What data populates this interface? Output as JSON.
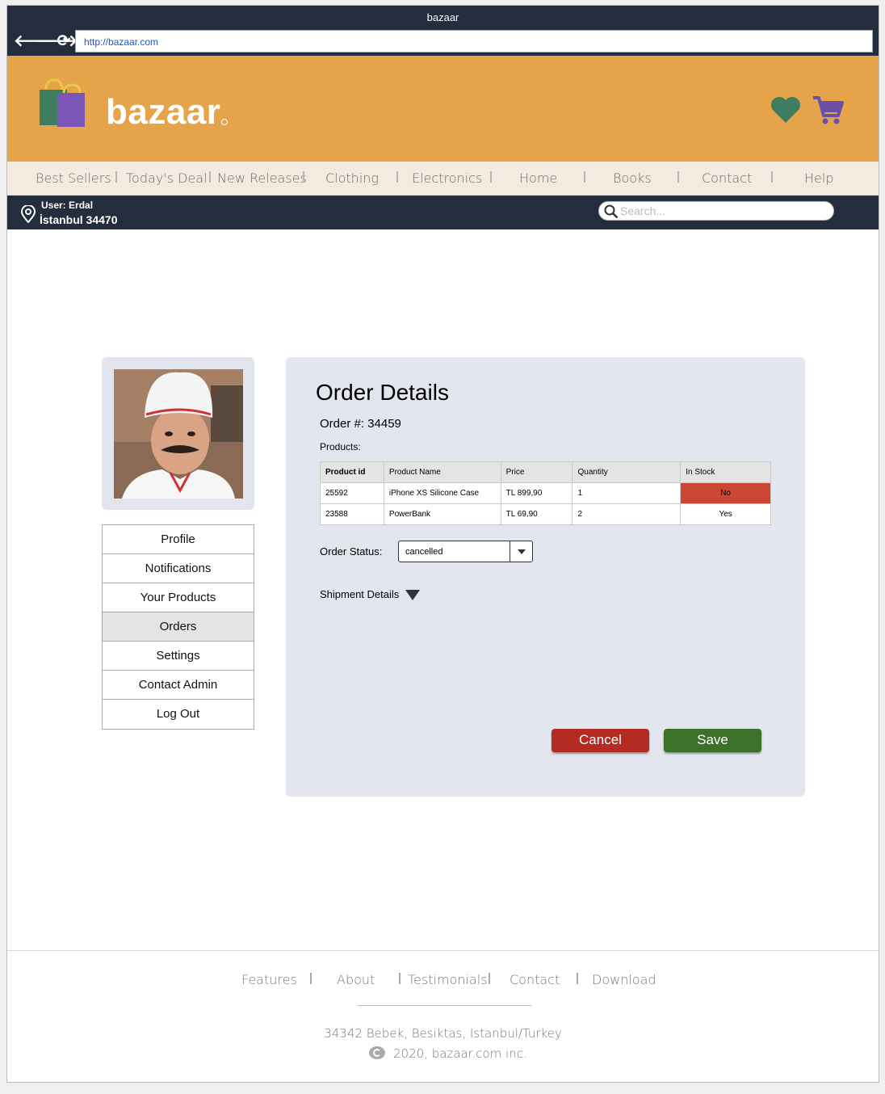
{
  "browser": {
    "title": "bazaar",
    "url": "http://bazaar.com",
    "nav_back": "🡐",
    "nav_forward": "🡒",
    "nav_reload": "⟳"
  },
  "brand": {
    "name": "bazaar",
    "header_color": "#e6a44a",
    "heart_color": "#3e7d5f",
    "cart_color": "#6b4fa8"
  },
  "menu": {
    "best_sellers": "Best Sellers",
    "todays_deal": "Today's Deal",
    "new_releases": "New Releases",
    "clothing": "Clothing",
    "electronics": "Electronics",
    "home": "Home",
    "books": "Books",
    "contact": "Contact",
    "help": "Help"
  },
  "user": {
    "name": "User: Erdal",
    "location": "İstanbul 34470"
  },
  "search": {
    "placeholder": "Search..."
  },
  "sidebar": {
    "profile": "Profile",
    "notifications": "Notifications",
    "your_products": "Your Products",
    "orders": "Orders",
    "settings": "Settings",
    "contact_admin": "Contact Admin",
    "log_out": "Log Out"
  },
  "order": {
    "heading": "Order Details",
    "number": "Order #: 34459",
    "products_label": "Products:",
    "columns": {
      "id": "Product id",
      "name": "Product Name",
      "price": "Price",
      "quantity": "Quantity",
      "stock": "In Stock"
    },
    "rows": [
      {
        "id": "25592",
        "name": "iPhone XS Silicone Case",
        "price": "TL 899,90",
        "quantity": "1",
        "stock": "No"
      },
      {
        "id": "23588",
        "name": "PowerBank",
        "price": "TL 69,90",
        "quantity": "2",
        "stock": "Yes"
      }
    ],
    "status_label": "Order Status:",
    "status_value": "cancelled",
    "shipment_label": "Shipment Details",
    "cancel_label": "Cancel",
    "save_label": "Save"
  },
  "footer": {
    "features": "Features",
    "about": "About",
    "testimonials": "Testimonials",
    "contact": "Contact",
    "download": "Download",
    "address": "34342 Bebek, Besiktas, Istanbul/Turkey",
    "copyright": "2020, bazaar.com inc."
  }
}
